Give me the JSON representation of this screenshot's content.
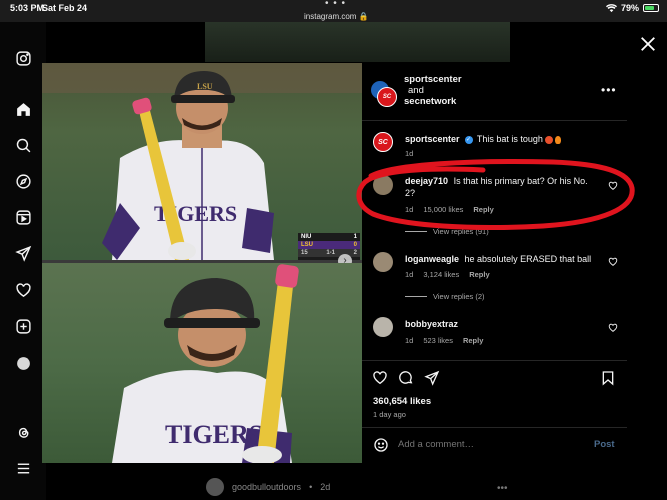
{
  "status_bar": {
    "time": "5:03 PM",
    "date": "Sat Feb 24",
    "url": "instagram.com",
    "battery": "79%",
    "battery_level": 0.79
  },
  "sidebar": {
    "items": [
      {
        "name": "instagram-logo-icon"
      },
      {
        "name": "home-icon"
      },
      {
        "name": "search-icon"
      },
      {
        "name": "explore-icon"
      },
      {
        "name": "reels-icon"
      },
      {
        "name": "messages-icon"
      },
      {
        "name": "notifications-icon"
      },
      {
        "name": "create-icon"
      },
      {
        "name": "profile-icon"
      },
      {
        "name": "threads-icon"
      },
      {
        "name": "menu-icon"
      }
    ]
  },
  "background_feed": {
    "next_post_user": "goodbulloutdoors",
    "next_post_time": "2d"
  },
  "post": {
    "header": {
      "author_1": "sportscenter",
      "joiner": "and",
      "author_2": "secnetwork"
    },
    "scorebug": {
      "team_1": "NIU",
      "score_1": "1",
      "team_2": "LSU",
      "score_2": "0",
      "inning": "15",
      "count": "1-1",
      "outs": "2"
    },
    "caption": {
      "user": "sportscenter",
      "text": "This bat is tough",
      "time": "1d"
    },
    "comments": [
      {
        "user": "deejay710",
        "text": "Is that his primary bat? Or his No. 2?",
        "time": "1d",
        "likes": "15,000 likes",
        "reply": "Reply",
        "view_replies": "View replies (91)"
      },
      {
        "user": "loganweagle",
        "text": "he absolutely ERASED that ball",
        "time": "1d",
        "likes": "3,124 likes",
        "reply": "Reply",
        "view_replies": "View replies (2)"
      },
      {
        "user": "bobbyextraz",
        "text": "",
        "time": "1d",
        "likes": "523 likes",
        "reply": "Reply"
      }
    ],
    "likes_count": "360,654 likes",
    "posted_ago": "1 day ago",
    "add_comment_placeholder": "Add a comment…",
    "post_label": "Post"
  },
  "colors": {
    "background": "#000000",
    "text": "#f5f5f5",
    "muted": "#a8a8a8",
    "link_blue": "#3797f0",
    "annotation_red": "#e0141e",
    "lsu_purple": "#4a2a7a",
    "lsu_gold": "#f2c230"
  }
}
